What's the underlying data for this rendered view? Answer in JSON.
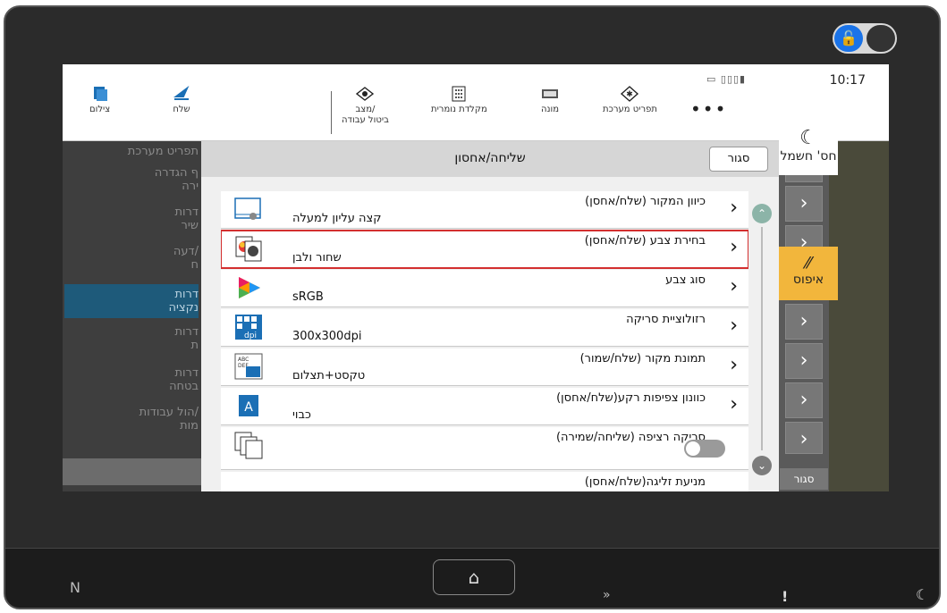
{
  "status": {
    "time": "10:17"
  },
  "toolbar": {
    "copy_label": "צילום",
    "send_label": "שלח",
    "job_status_label_1": "מצב/",
    "job_status_label_2": "ביטול עבודה",
    "numeric_keypad_label": "מקלדת נומרית",
    "counter_label": "מונה",
    "system_menu_label": "תפריט מערכת",
    "more_label": "•••"
  },
  "left_menu": {
    "items": [
      {
        "label": "תפריט מערכת"
      },
      {
        "label": "ף הגדרה\nירה"
      },
      {
        "label": "דרות\nשיר"
      },
      {
        "label": "דעה/\nח"
      },
      {
        "label": "דרות\nנקציה"
      },
      {
        "label": "דרות\nת"
      },
      {
        "label": "דרות\nבטחה"
      },
      {
        "label": "הול עבודות/\nמות"
      }
    ]
  },
  "dialog": {
    "title": "שליחה/אחסון",
    "close_label": "סגור",
    "rows": [
      {
        "label": "כיוון המקור (שלח/אחסן)",
        "value": "קצה עליון למעלה"
      },
      {
        "label": "בחירת צבע (שלח/אחסן)",
        "value": "שחור ולבן"
      },
      {
        "label": "סוג צבע",
        "value": "sRGB"
      },
      {
        "label": "רזולוציית סריקה",
        "value": "300x300dpi"
      },
      {
        "label": "תמונת מקור (שלח/שמור)",
        "value": "טקסט+תצלום"
      },
      {
        "label": "כוונון צפיפות רקע(שלח/אחסן)",
        "value": "כבוי"
      },
      {
        "label": "סריקה רציפה (שליחה/שמירה)",
        "value": ""
      },
      {
        "label": "מניעת זליגה(שלח/אחסן)",
        "value": ""
      }
    ]
  },
  "right_panel": {
    "sleep_label": "חס' חשמל",
    "reset_label": "איפוס",
    "close_label": "סגור"
  },
  "hardware": {
    "home_glyph": "⌂",
    "nfc_glyph": "N",
    "forward_glyph": "»",
    "warn_glyph": "!",
    "moon_glyph": "☾"
  }
}
